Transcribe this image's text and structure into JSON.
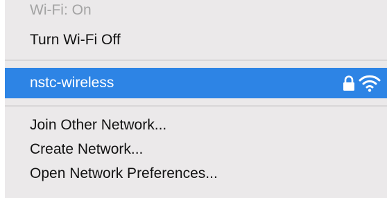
{
  "menu": {
    "status_text": "Wi-Fi: On",
    "toggle_label": "Turn Wi-Fi Off",
    "networks": [
      {
        "name": "nstc-wireless",
        "secured": true,
        "selected": true,
        "lock_icon": "lock-icon",
        "signal_icon": "wifi-signal-icon"
      }
    ],
    "actions": {
      "join_other": "Join Other Network...",
      "create_network": "Create Network...",
      "open_prefs": "Open Network Preferences..."
    }
  },
  "colors": {
    "menu_background": "#ebe9ea",
    "highlight": "#2d84e5",
    "separator": "#d9d7d8",
    "disabled_text": "#a3a3a3",
    "text": "#121212"
  }
}
